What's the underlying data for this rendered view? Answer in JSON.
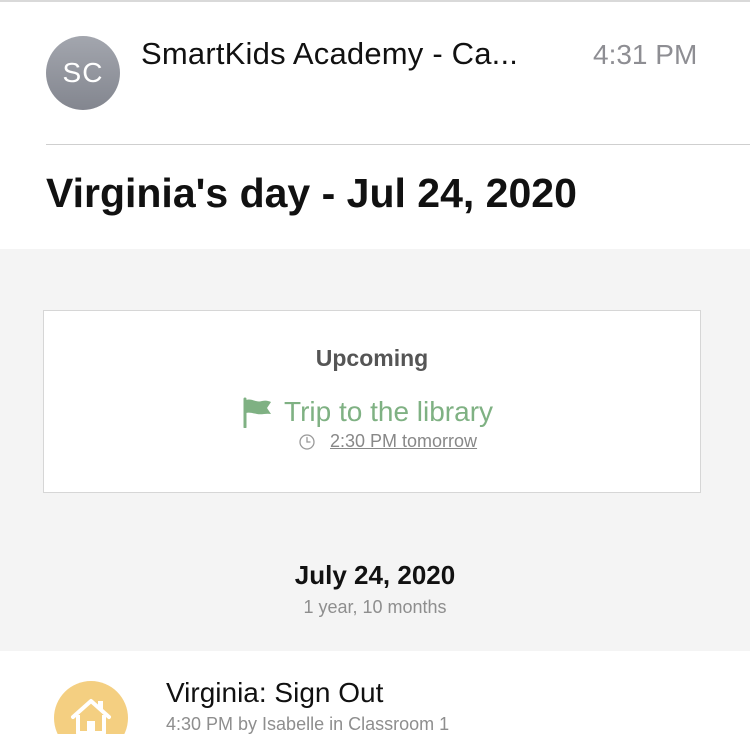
{
  "message": {
    "avatar_initials": "SC",
    "sender": "SmartKids Academy - Ca...",
    "time": "4:31 PM",
    "subject": "Virginia's day - Jul 24, 2020"
  },
  "upcoming": {
    "title": "Upcoming",
    "event_title": "Trip to the library",
    "event_time": "2:30 PM tomorrow",
    "icon": "flag-icon",
    "accent_color": "#7fb183"
  },
  "day": {
    "date": "July 24, 2020",
    "age": "1 year, 10 months"
  },
  "activity": {
    "title": "Virginia: Sign Out",
    "meta": "4:30 PM by Isabelle in Classroom 1",
    "icon": "home-icon",
    "icon_bg": "#f4cf81"
  }
}
